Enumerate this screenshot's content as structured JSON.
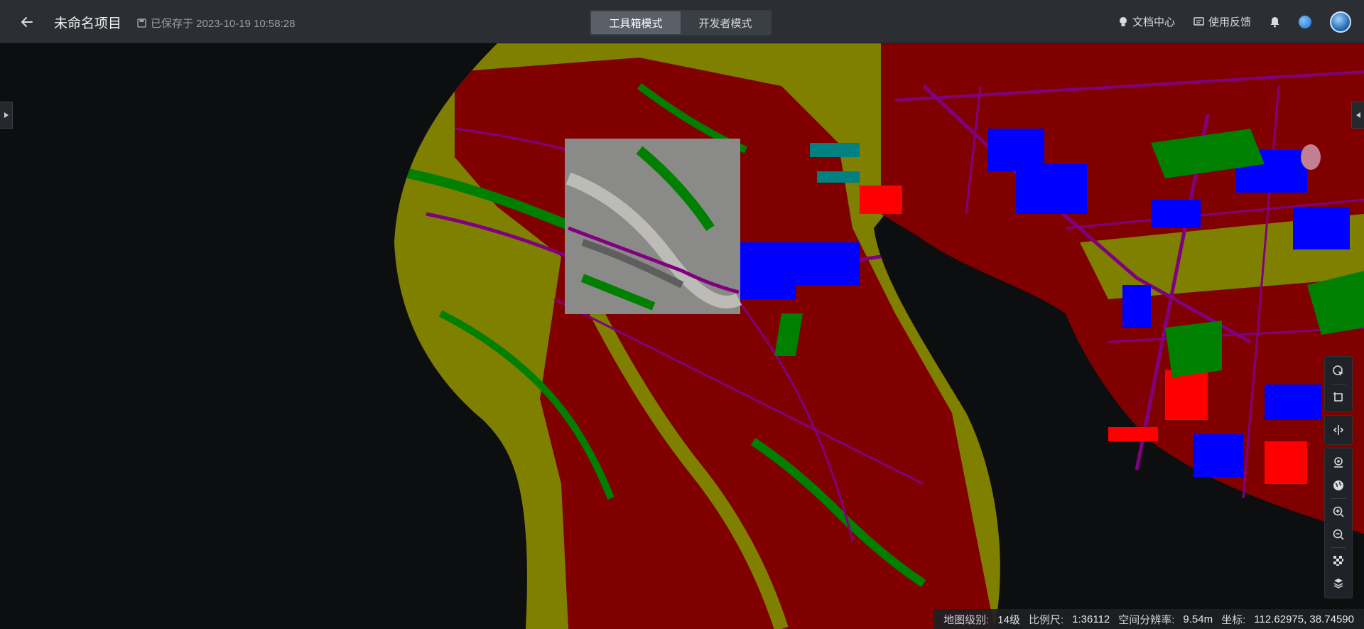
{
  "header": {
    "project_title": "未命名项目",
    "save_status": "已保存于 2023-10-19 10:58:28",
    "modes": [
      {
        "label": "工具箱模式",
        "active": true
      },
      {
        "label": "开发者模式",
        "active": false
      }
    ],
    "docs_label": "文档中心",
    "feedback_label": "使用反馈"
  },
  "toolbar": {
    "tools": [
      "cursor-select-icon",
      "crop-region-icon",
      "split-compare-icon",
      "location-pin-icon",
      "globe-icon",
      "zoom-in-icon",
      "zoom-out-icon",
      "checker-grid-icon",
      "layer-stack-icon"
    ]
  },
  "status": {
    "level_label": "地图级别:",
    "level_value": "14级",
    "scale_label": "比例尺:",
    "scale_value": "1:36112",
    "resolution_label": "空间分辨率:",
    "resolution_value": "9.54m",
    "coord_label": "坐标:",
    "coord_value": "112.62975, 38.74590"
  },
  "map_legend_colors": {
    "building": "#0000ff",
    "road": "#800080",
    "farmland": "#808000",
    "forest": "#008000",
    "bare_land": "#800000",
    "water": "#008080"
  }
}
